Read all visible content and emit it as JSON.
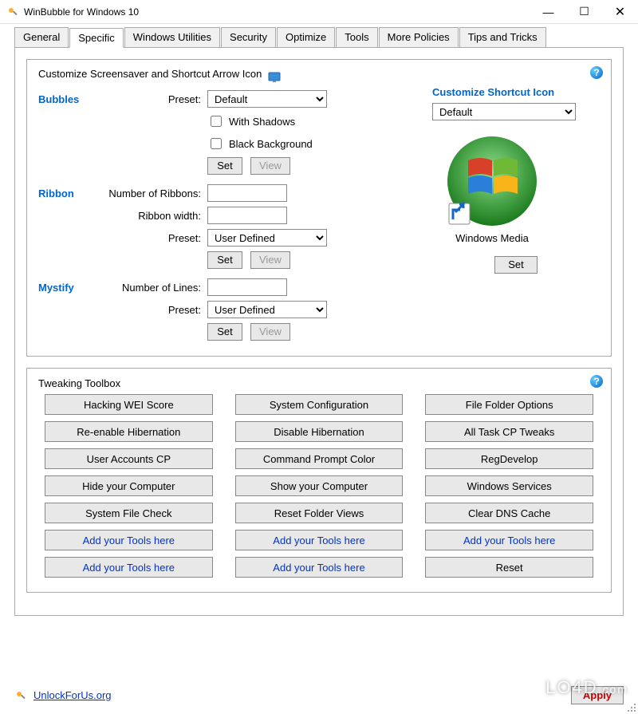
{
  "window": {
    "title": "WinBubble for Windows 10"
  },
  "tabs": [
    "General",
    "Specific",
    "Windows Utilities",
    "Security",
    "Optimize",
    "Tools",
    "More Policies",
    "Tips and Tricks"
  ],
  "active_tab": 1,
  "group1": {
    "title": "Customize Screensaver and Shortcut Arrow Icon",
    "bubbles": {
      "label": "Bubbles",
      "preset_label": "Preset:",
      "preset_value": "Default",
      "with_shadows_label": "With Shadows",
      "black_bg_label": "Black Background",
      "set": "Set",
      "view": "View"
    },
    "ribbon": {
      "label": "Ribbon",
      "num_label": "Number of Ribbons:",
      "num_value": "",
      "width_label": "Ribbon width:",
      "width_value": "",
      "preset_label": "Preset:",
      "preset_value": "User Defined",
      "set": "Set",
      "view": "View"
    },
    "mystify": {
      "label": "Mystify",
      "num_label": "Number of Lines:",
      "num_value": "",
      "preset_label": "Preset:",
      "preset_value": "User Defined",
      "set": "Set",
      "view": "View"
    },
    "shortcut": {
      "title": "Customize Shortcut Icon",
      "value": "Default",
      "caption": "Windows Media",
      "set": "Set"
    }
  },
  "group2": {
    "title": "Tweaking Toolbox",
    "buttons": [
      {
        "label": "Hacking WEI Score",
        "blue": false
      },
      {
        "label": "System Configuration",
        "blue": false
      },
      {
        "label": "File Folder Options",
        "blue": false
      },
      {
        "label": "Re-enable Hibernation",
        "blue": false
      },
      {
        "label": "Disable Hibernation",
        "blue": false
      },
      {
        "label": "All Task CP Tweaks",
        "blue": false
      },
      {
        "label": "User Accounts CP",
        "blue": false
      },
      {
        "label": "Command Prompt Color",
        "blue": false
      },
      {
        "label": "RegDevelop",
        "blue": false
      },
      {
        "label": "Hide your Computer",
        "blue": false
      },
      {
        "label": "Show your Computer",
        "blue": false
      },
      {
        "label": "Windows Services",
        "blue": false
      },
      {
        "label": "System File Check",
        "blue": false
      },
      {
        "label": "Reset Folder Views",
        "blue": false
      },
      {
        "label": "Clear DNS Cache",
        "blue": false
      },
      {
        "label": "Add your Tools here",
        "blue": true
      },
      {
        "label": "Add your Tools here",
        "blue": true
      },
      {
        "label": "Add your Tools here",
        "blue": true
      },
      {
        "label": "Add your Tools here",
        "blue": true
      },
      {
        "label": "Add your Tools here",
        "blue": true
      },
      {
        "label": "Reset",
        "blue": false
      }
    ]
  },
  "footer": {
    "link": "UnlockForUs.org",
    "apply": "Apply"
  },
  "watermark": "LO4D.com"
}
